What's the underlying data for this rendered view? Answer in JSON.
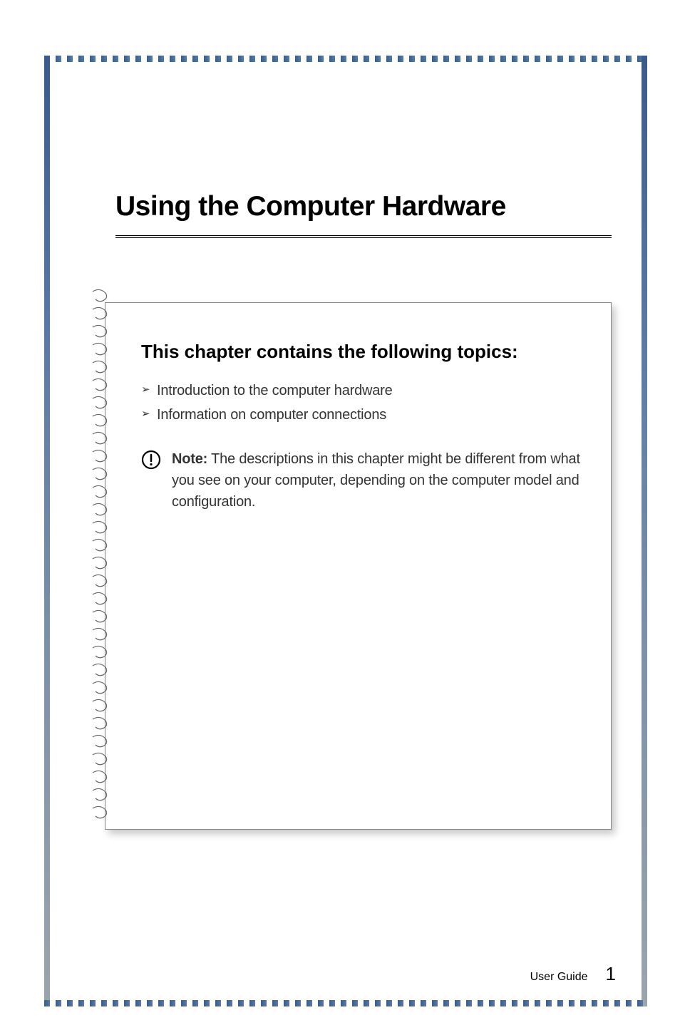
{
  "chapter": {
    "title": "Using the Computer Hardware"
  },
  "section": {
    "heading": "This chapter contains the following topics:",
    "topics": [
      "Introduction to the computer hardware",
      "Information on computer connections"
    ]
  },
  "note": {
    "label": "Note:",
    "text": " The descriptions in this chapter might be different from what you see on your computer, depending on the computer model and configuration."
  },
  "footer": {
    "label": "User Guide",
    "page_number": "1"
  }
}
